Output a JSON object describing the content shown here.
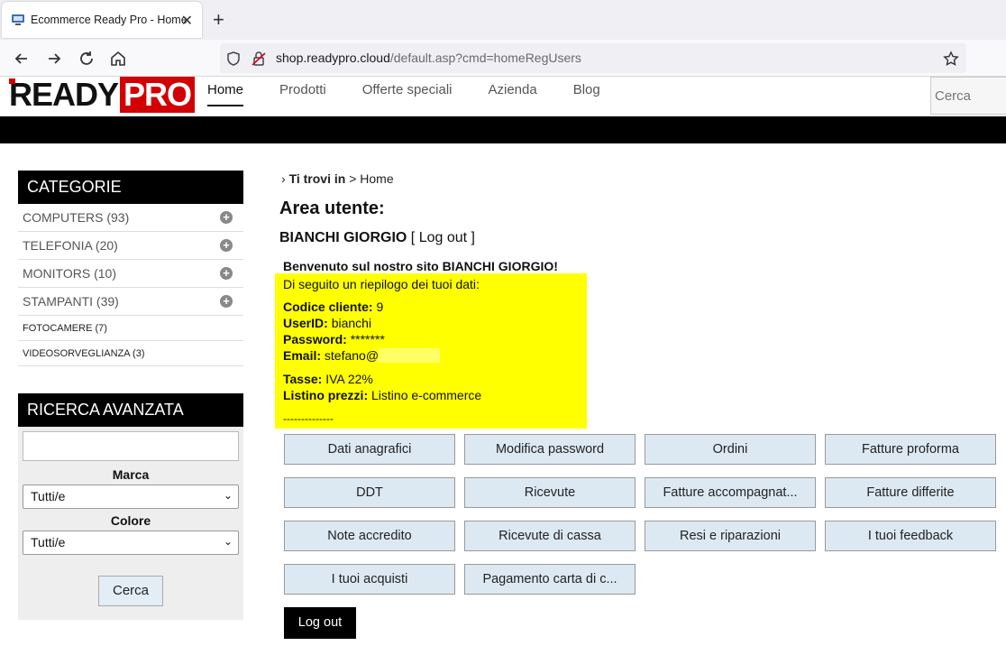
{
  "browser": {
    "tab_title": "Ecommerce Ready Pro - Home",
    "url_host": "shop.readypro.cloud",
    "url_path": "/default.asp?cmd=homeRegUsers"
  },
  "header": {
    "logo_left": "READY",
    "logo_right": "PRO",
    "menu": [
      "Home",
      "Prodotti",
      "Offerte speciali",
      "Azienda",
      "Blog"
    ],
    "active_menu": "Home",
    "search_placeholder": "Cerca"
  },
  "sidebar": {
    "categories_title": "CATEGORIE",
    "categories": [
      {
        "label": "COMPUTERS (93)"
      },
      {
        "label": "TELEFONIA (20)"
      },
      {
        "label": "MONITORS (10)"
      },
      {
        "label": "STAMPANTI (39)"
      },
      {
        "label": "FOTOCAMERE (7)"
      },
      {
        "label": "VIDEOSORVEGLIANZA (3)"
      }
    ],
    "advanced_title": "RICERCA AVANZATA",
    "marca_label": "Marca",
    "marca_value": "Tutti/e",
    "colore_label": "Colore",
    "colore_value": "Tutti/e",
    "search_button": "Cerca"
  },
  "main": {
    "breadcrumb_prefix": "Ti trovi in",
    "breadcrumb_sep": ">",
    "breadcrumb_current": "Home",
    "title": "Area utente:",
    "user_name": "BIANCHI GIORGIO",
    "logout_link": "[ Log out ]",
    "welcome": "Benvenuto sul nostro sito BIANCHI GIORGIO!",
    "summary_intro": "Di seguito un riepilogo dei tuoi dati:",
    "codice_label": "Codice cliente:",
    "codice_value": "9",
    "userid_label": "UserID:",
    "userid_value": "bianchi",
    "password_label": "Password:",
    "password_value": "*******",
    "email_label": "Email:",
    "email_value": "stefano@",
    "tasse_label": "Tasse:",
    "tasse_value": "IVA 22%",
    "listino_label": "Listino prezzi:",
    "listino_value": "Listino e-commerce",
    "separator": "--------------",
    "buttons": [
      "Dati anagrafici",
      "Modifica password",
      "Ordini",
      "Fatture proforma",
      "DDT",
      "Ricevute",
      "Fatture accompagnat...",
      "Fatture differite",
      "Note accredito",
      "Ricevute di cassa",
      "Resi e riparazioni",
      "I tuoi feedback",
      "I tuoi acquisti",
      "Pagamento carta di c..."
    ],
    "logout_button": "Log out"
  },
  "colors": {
    "highlight": "#ffff00",
    "brand_red": "#d20000",
    "button_bg": "#dde9f2"
  }
}
